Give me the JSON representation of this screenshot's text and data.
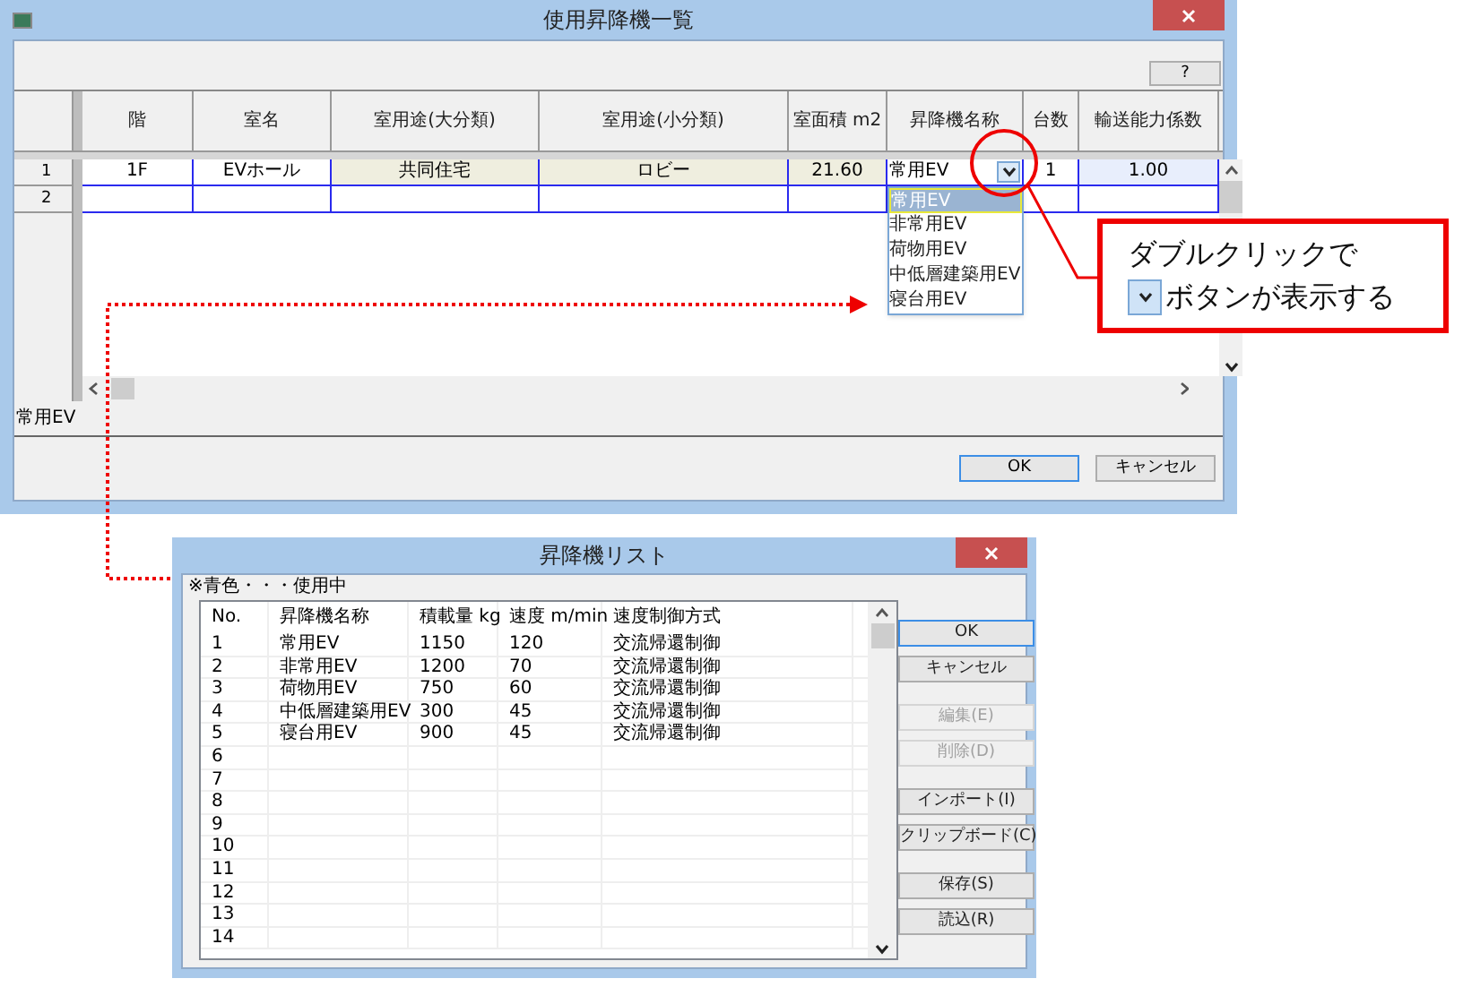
{
  "main_window": {
    "title": "使用昇降機一覧",
    "help_button": "?",
    "columns": [
      "階",
      "室名",
      "室用途(大分類)",
      "室用途(小分類)",
      "室面積 m2",
      "昇降機名称",
      "台数",
      "輸送能力係数"
    ],
    "rows": [
      {
        "row_number": "1",
        "cells": [
          {
            "kind": "text",
            "text": "1F"
          },
          {
            "kind": "text",
            "text": "EVホール"
          },
          {
            "kind": "readonly",
            "text": "共同住宅"
          },
          {
            "kind": "readonly",
            "text": "ロビー"
          },
          {
            "kind": "readonly",
            "text": "21.60"
          },
          {
            "kind": "dropdown",
            "text": "常用EV"
          },
          {
            "kind": "text",
            "text": "1"
          },
          {
            "kind": "input",
            "text": "1.00"
          }
        ]
      },
      {
        "row_number": "2"
      }
    ],
    "dropdown_items": [
      {
        "label": "常用EV",
        "selected": true
      },
      {
        "label": "非常用EV",
        "selected": false
      },
      {
        "label": "荷物用EV",
        "selected": false
      },
      {
        "label": "中低層建築用EV",
        "selected": false
      },
      {
        "label": "寝台用EV",
        "selected": false
      }
    ],
    "status_text": "常用EV",
    "buttons": [
      {
        "label": "OK",
        "default": true
      },
      {
        "label": "キャンセル",
        "default": false
      }
    ]
  },
  "callout": {
    "line_1": "ダブルクリックで",
    "line_2": "ボタンが表示する"
  },
  "list_window": {
    "title": "昇降機リスト",
    "note": "※青色・・・使用中",
    "columns": [
      "No.",
      "昇降機名称",
      "積載量 kg",
      "速度 m/min",
      "速度制御方式"
    ],
    "rows": [
      {
        "cells": [
          "1",
          "常用EV",
          "1150",
          "120",
          "交流帰還制御"
        ]
      },
      {
        "cells": [
          "2",
          "非常用EV",
          "1200",
          "70",
          "交流帰還制御"
        ]
      },
      {
        "cells": [
          "3",
          "荷物用EV",
          "750",
          "60",
          "交流帰還制御"
        ]
      },
      {
        "cells": [
          "4",
          "中低層建築用EV",
          "300",
          "45",
          "交流帰還制御"
        ]
      },
      {
        "cells": [
          "5",
          "寝台用EV",
          "900",
          "45",
          "交流帰還制御"
        ]
      },
      {
        "cells": [
          "6"
        ]
      },
      {
        "cells": [
          "7"
        ]
      },
      {
        "cells": [
          "8"
        ]
      },
      {
        "cells": [
          "9"
        ]
      },
      {
        "cells": [
          "10"
        ]
      },
      {
        "cells": [
          "11"
        ]
      },
      {
        "cells": [
          "12"
        ]
      },
      {
        "cells": [
          "13"
        ]
      },
      {
        "cells": [
          "14"
        ]
      }
    ],
    "button_groups": [
      [
        {
          "label": "OK",
          "default": true,
          "disabled": false
        },
        {
          "label": "キャンセル",
          "default": false,
          "disabled": false
        }
      ],
      [
        {
          "label": "編集(E)",
          "default": false,
          "disabled": true
        },
        {
          "label": "削除(D)",
          "default": false,
          "disabled": true
        }
      ],
      [
        {
          "label": "インポート(I)",
          "default": false,
          "disabled": false
        },
        {
          "label": "クリップボード(C)",
          "default": false,
          "disabled": false
        }
      ],
      [
        {
          "label": "保存(S)",
          "default": false,
          "disabled": false
        },
        {
          "label": "読込(R)",
          "default": false,
          "disabled": false
        }
      ]
    ]
  }
}
